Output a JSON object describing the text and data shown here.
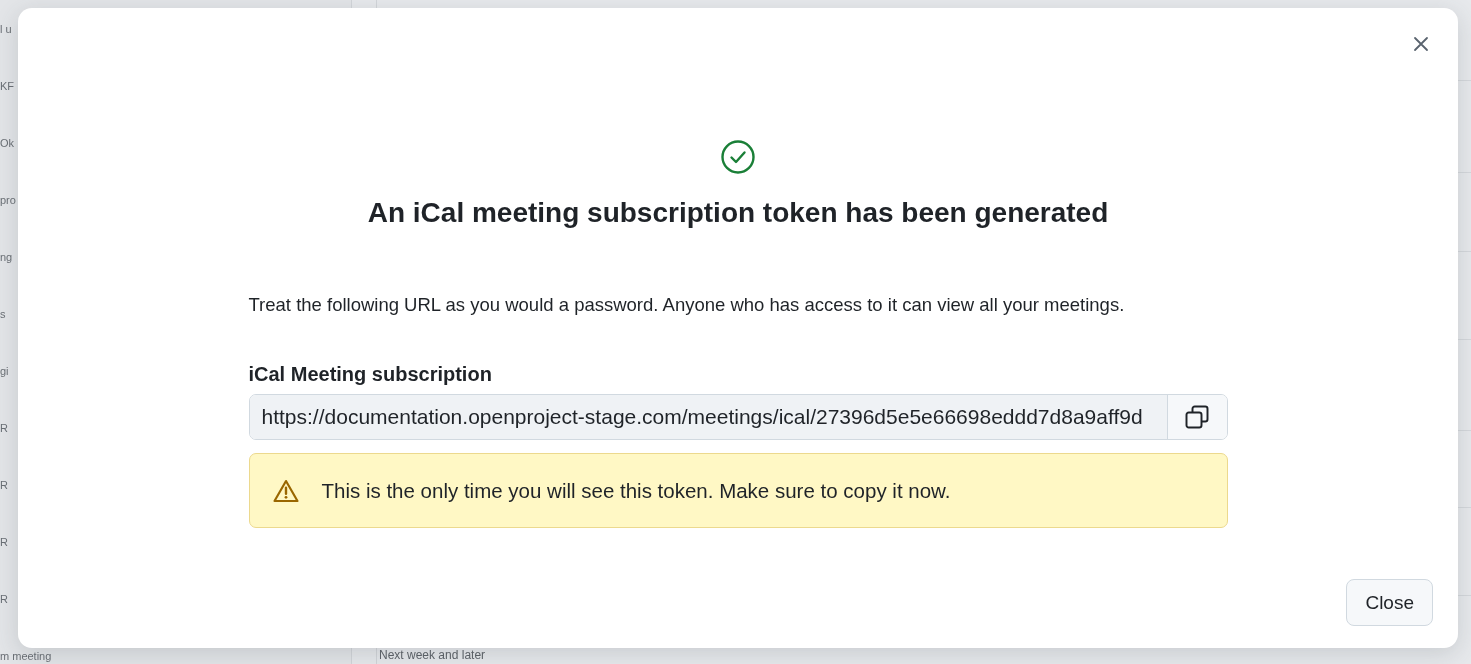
{
  "background": {
    "sidebar_items": [
      "l u",
      "KF",
      "Ok",
      "pro",
      "ng",
      "s",
      "gi",
      "R",
      "R",
      "R",
      "R",
      "m meeting"
    ],
    "section_heading": "Next week and later"
  },
  "dialog": {
    "title": "An iCal meeting subscription token has been generated",
    "description": "Treat the following URL as you would a password. Anyone who has access to it can view all your meetings.",
    "field": {
      "label": "iCal Meeting subscription",
      "value": "https://documentation.openproject-stage.com/meetings/ical/27396d5e5e66698eddd7d8a9aff9d"
    },
    "warning": {
      "text": "This is the only time you will see this token. Make sure to copy it now."
    },
    "buttons": [
      "Close"
    ]
  }
}
